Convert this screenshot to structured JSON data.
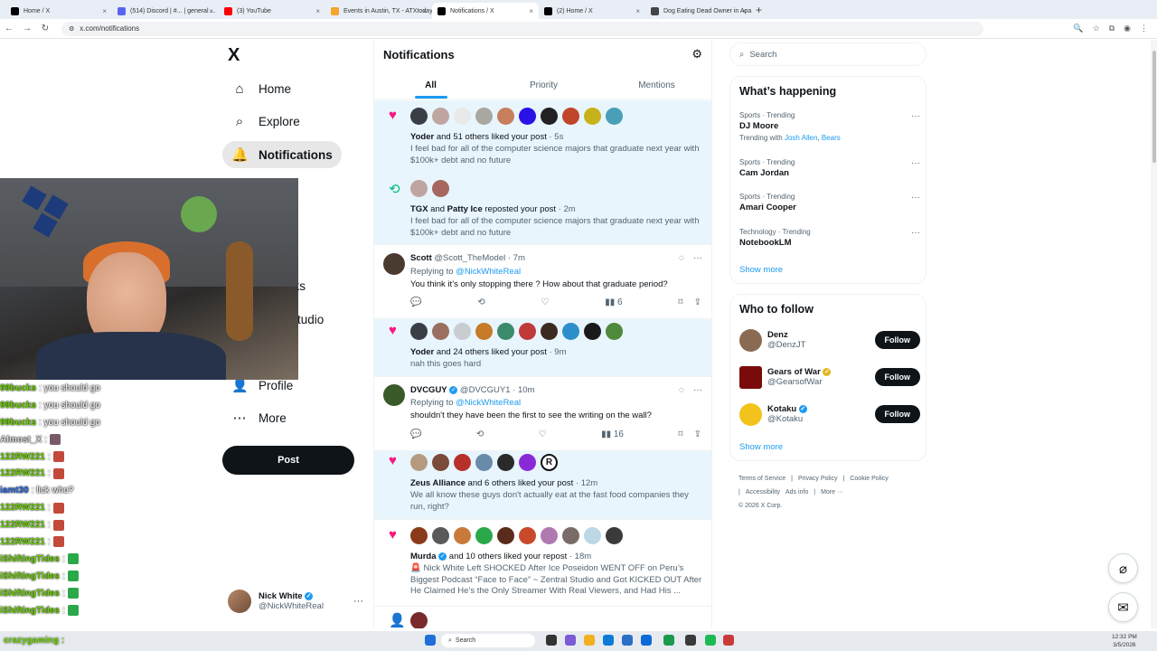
{
  "browser": {
    "tabs": [
      {
        "label": "Home / X",
        "color": "#000000",
        "active": false
      },
      {
        "label": "(514) Discord | #... | general ...",
        "color": "#5865f2",
        "active": false
      },
      {
        "label": "(3) YouTube",
        "color": "#ff0000",
        "active": false
      },
      {
        "label": "Events in Austin, TX - ATXtoday",
        "color": "#f4a52a",
        "active": false
      },
      {
        "label": "Notifications / X",
        "color": "#000000",
        "active": true
      },
      {
        "label": "(2) Home / X",
        "color": "#000000",
        "active": false
      },
      {
        "label": "Dog Eating Dead Owner in Apa...",
        "color": "#444444",
        "active": false
      }
    ],
    "url": "x.com/notifications"
  },
  "nav": {
    "logo": "X",
    "items": [
      {
        "label": "Home",
        "icon": "home-icon"
      },
      {
        "label": "Explore",
        "icon": "search-icon"
      },
      {
        "label": "Notifications",
        "icon": "bell-icon"
      },
      {
        "label": "n",
        "icon": ""
      },
      {
        "label": "rks",
        "icon": ""
      },
      {
        "label": "Studio",
        "icon": ""
      },
      {
        "label": "Profile",
        "icon": "person-icon"
      },
      {
        "label": "More",
        "icon": "more-circle-icon"
      }
    ],
    "post_label": "Post",
    "account": {
      "name": "Nick White",
      "handle": "@NickWhiteReal"
    }
  },
  "chat": [
    {
      "user": "99bucks",
      "msg": ": you should go",
      "cls": ""
    },
    {
      "user": "99bucks",
      "msg": ": you should go",
      "cls": ""
    },
    {
      "user": "99bucks",
      "msg": ": you should go",
      "cls": ""
    },
    {
      "user": "Almost_X",
      "msg": ":",
      "cls": "gray"
    },
    {
      "user": "122RW221",
      "msg": ":",
      "cls": ""
    },
    {
      "user": "122RW221",
      "msg": ":",
      "cls": ""
    },
    {
      "user": "iamt30",
      "msg": ": lick who?",
      "cls": "blue"
    },
    {
      "user": "122RW221",
      "msg": ":",
      "cls": ""
    },
    {
      "user": "122RW221",
      "msg": ":",
      "cls": ""
    },
    {
      "user": "122RW221",
      "msg": ":",
      "cls": ""
    },
    {
      "user": "iShiftingTides",
      "msg": ":",
      "cls": ""
    },
    {
      "user": "iShiftingTides",
      "msg": ":",
      "cls": ""
    },
    {
      "user": "iShiftingTides",
      "msg": ":",
      "cls": ""
    },
    {
      "user": "iShiftingTides",
      "msg": ":",
      "cls": ""
    }
  ],
  "center": {
    "title": "Notifications",
    "tabs": [
      "All",
      "Priority",
      "Mentions"
    ],
    "notifs": {
      "n1": {
        "line_bold": "Yoder",
        "line_rest": " and 51 others liked your post",
        "time": " · 5s",
        "text": "I feel bad for all of the computer science majors that graduate next year with $100k+ debt and no future"
      },
      "n2": {
        "a": "TGX",
        "mid": " and ",
        "b": "Patty Ice",
        "rest": " reposted your post",
        "time": " · 2m",
        "text": "I feel bad for all of the computer science majors that graduate next year with $100k+ debt and no future"
      },
      "n3": {
        "name": "Scott",
        "handle": " @Scott_TheModel",
        "time": " · 7m",
        "replying": "Replying to ",
        "to": "@NickWhiteReal",
        "text": "You think it’s only stopping there ? How about that graduate period?",
        "views": "6"
      },
      "n4": {
        "line_bold": "Yoder",
        "line_rest": " and 24 others liked your post",
        "time": " · 9m",
        "text": "nah this goes hard"
      },
      "n5": {
        "name": "DVCGUY",
        "handle": " @DVCGUY1",
        "time": " · 10m",
        "replying": "Replying to ",
        "to": "@NickWhiteReal",
        "text": "shouldn't they have been the first to see the writing on the wall?",
        "views": "16"
      },
      "n6": {
        "line_bold": "Zeus Alliance",
        "line_rest": " and 6 others liked your post",
        "time": " · 12m",
        "text": "We all know these guys don't actually eat at the fast food companies they run, right?"
      },
      "n7": {
        "line_bold": "Murda",
        "line_rest": " and 10 others liked your repost",
        "time": " · 18m",
        "text": "🚨 Nick White Left SHOCKED After Ice Poseidon WENT OFF on Peru’s Biggest Podcast “Face to Face” ~ Zentral Studio and Got KICKED OUT After He Claimed He’s the Only Streamer With Real Viewers, and Had His ..."
      }
    }
  },
  "right": {
    "search_placeholder": "Search",
    "happening_title": "What’s happening",
    "trends": [
      {
        "cat": "Sports · Trending",
        "name": "DJ Moore",
        "sub_prefix": "Trending with ",
        "sub_a": "Josh Allen",
        "sub_sep": ", ",
        "sub_b": "Bears"
      },
      {
        "cat": "Sports · Trending",
        "name": "Cam Jordan"
      },
      {
        "cat": "Sports · Trending",
        "name": "Amari Cooper"
      },
      {
        "cat": "Technology · Trending",
        "name": "NotebookLM"
      }
    ],
    "show_more": "Show more",
    "wtf_title": "Who to follow",
    "follow": [
      {
        "name": "Denz",
        "handle": "@DenzJT",
        "btn": "Follow",
        "color": "#8a6a52"
      },
      {
        "name": "Gears of War",
        "handle": "@GearsofWar",
        "btn": "Follow",
        "color": "#7a0b0b"
      },
      {
        "name": "Kotaku",
        "handle": "@Kotaku",
        "btn": "Follow",
        "color": "#f2c31a"
      }
    ],
    "show_more2": "Show more",
    "footer": [
      "Terms of Service",
      "|",
      "Privacy Policy",
      "|",
      "Cookie Policy",
      "|",
      "Accessibility",
      "Ads info",
      "|",
      "More ···",
      "© 2026 X Corp."
    ]
  },
  "taskbar": {
    "search": "Search",
    "time": "12:32 PM",
    "date": "3/5/2026",
    "user": "crazygaming :"
  }
}
